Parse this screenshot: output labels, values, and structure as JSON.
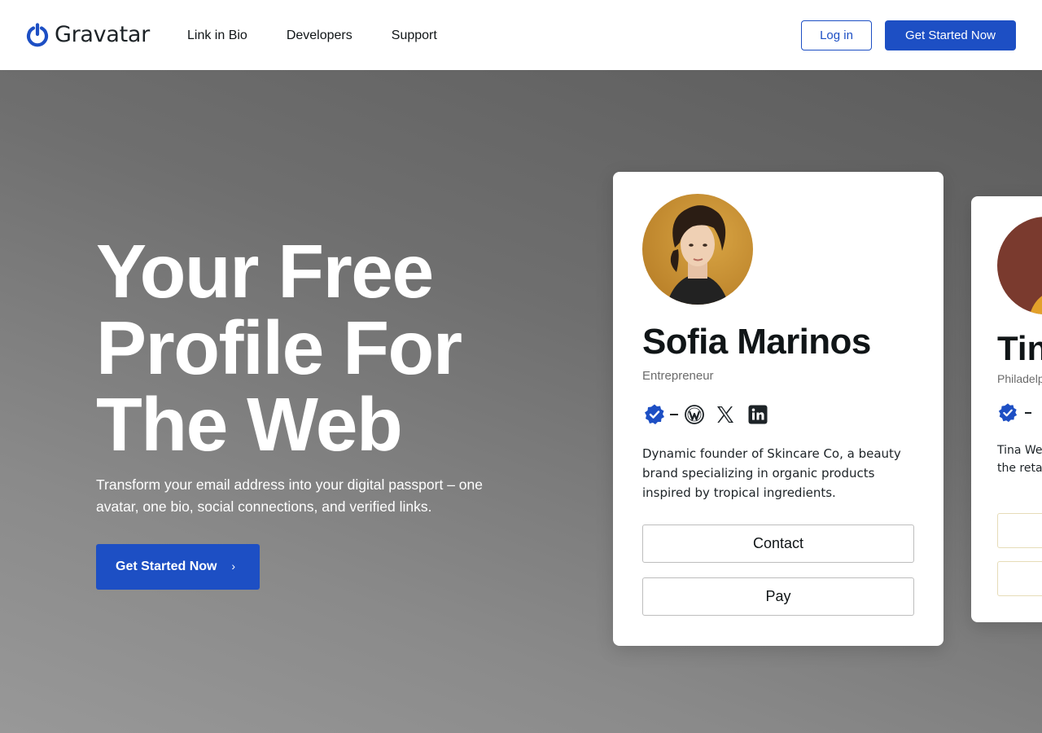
{
  "brand": {
    "name": "Gravatar",
    "logo_icon": "gravatar-power-icon",
    "accent": "#1d4fc4"
  },
  "nav": {
    "items": [
      {
        "label": "Link in Bio"
      },
      {
        "label": "Developers"
      },
      {
        "label": "Support"
      }
    ]
  },
  "header": {
    "login_label": "Log in",
    "cta_label": "Get Started Now"
  },
  "hero": {
    "title": "Your Free Profile For The Web",
    "subtitle": "Transform your email address into your digital passport – one avatar, one bio, social connections, and verified links.",
    "cta_label": "Get Started Now",
    "cta_icon": "chevron-right-icon"
  },
  "profile_cards": [
    {
      "name": "Sofia Marinos",
      "role": "Entrepreneur",
      "verified_icon": "verified-badge-icon",
      "social_icons": [
        "wordpress-icon",
        "x-icon",
        "linkedin-icon"
      ],
      "bio": "Dynamic founder of Skincare Co, a beauty brand specializing in organic products inspired by tropical ingredients.",
      "contact_label": "Contact",
      "pay_label": "Pay"
    },
    {
      "name": "Tin",
      "location": "Philadelp",
      "verified_icon": "verified-badge-icon",
      "bio_line1": "Tina Wel",
      "bio_line2": "the retai"
    }
  ]
}
